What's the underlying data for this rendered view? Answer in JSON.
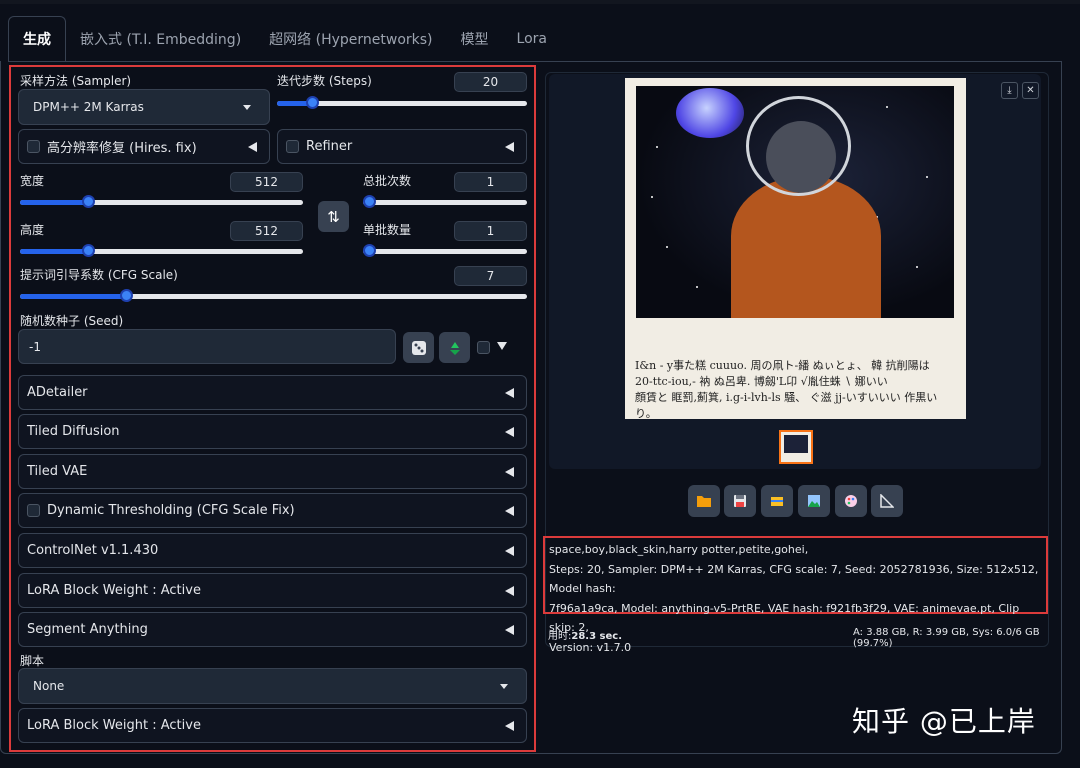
{
  "tabs": [
    "生成",
    "嵌入式 (T.I. Embedding)",
    "超网络 (Hypernetworks)",
    "模型",
    "Lora"
  ],
  "sampler": {
    "label": "采样方法 (Sampler)",
    "value": "DPM++ 2M Karras"
  },
  "steps": {
    "label": "迭代步数 (Steps)",
    "value": "20",
    "fraction": 0.14
  },
  "hires": {
    "label": "高分辨率修复 (Hires. fix)"
  },
  "refiner": {
    "label": "Refiner"
  },
  "width": {
    "label": "宽度",
    "value": "512",
    "fraction": 0.24
  },
  "height": {
    "label": "高度",
    "value": "512",
    "fraction": 0.24
  },
  "batch_count": {
    "label": "总批次数",
    "value": "1",
    "fraction": 0.0
  },
  "batch_size": {
    "label": "单批数量",
    "value": "1",
    "fraction": 0.0
  },
  "swap_icon": "⇅",
  "cfg": {
    "label": "提示词引导系数 (CFG Scale)",
    "value": "7",
    "fraction": 0.21
  },
  "seed": {
    "label": "随机数种子 (Seed)",
    "value": "-1"
  },
  "accordions": [
    "ADetailer",
    "Tiled Diffusion",
    "Tiled VAE",
    "Dynamic Thresholding (CFG Scale Fix)",
    "ControlNet v1.1.430",
    "LoRA Block Weight : Active",
    "Segment Anything"
  ],
  "script": {
    "label": "脚本",
    "value": "None"
  },
  "last_accordion": "LoRA Block Weight : Active",
  "handwriting": [
    "I&n - y事た糕 cuuuo. 周の凧ト-繙 ぬぃとょ、 韓 抗削陽は",
    "20-ttc-iou,- 衲 ぬ呂卑. 博劔'L卬 √胤住蛛 ∖ 娜いい",
    "顔賃と 眶罰,薊箕, i.g-i-lvh-ls 騒、 ぐ滋 jj-いすいいい 作黒いり。"
  ],
  "info": {
    "line1": "space,boy,black_skin,harry potter,petite,gohei,",
    "line2": "Steps: 20, Sampler: DPM++ 2M Karras, CFG scale: 7, Seed: 2052781936, Size: 512x512, Model hash:",
    "line3": "7f96a1a9ca, Model: anything-v5-PrtRE, VAE hash: f921fb3f29, VAE: animevae.pt, Clip skip: 2,",
    "line4": "Version: v1.7.0"
  },
  "stats": {
    "time_label": "用时:",
    "time_value": "28.3 sec.",
    "mem": "A: 3.88 GB, R: 3.99 GB, Sys: 6.0/6 GB (99.7%)"
  },
  "watermark": "知乎 @已上岸",
  "colors": {
    "accent": "#3b82f6",
    "highlight_border": "#dc3b3b",
    "background": "#0b0f19"
  }
}
